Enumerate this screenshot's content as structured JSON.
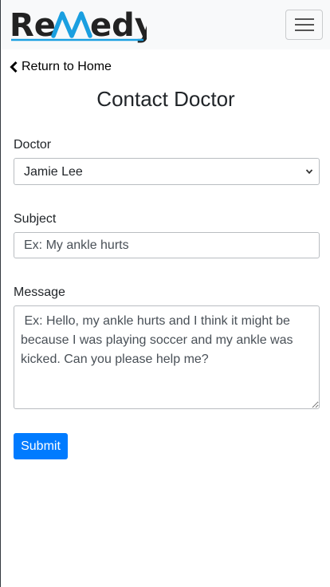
{
  "navbar": {
    "brand": {
      "left": "Re",
      "right": "edy"
    },
    "toggler_icon": "hamburger-menu-icon"
  },
  "back_link": {
    "label": "Return to Home",
    "icon": "chevron-left-icon"
  },
  "page_title": "Contact Doctor",
  "form": {
    "doctor": {
      "label": "Doctor",
      "selected": "Jamie Lee"
    },
    "subject": {
      "label": "Subject",
      "placeholder": "Ex: My ankle hurts",
      "value": ""
    },
    "message": {
      "label": "Message",
      "placeholder": " Ex: Hello, my ankle hurts and I think it might be because I was playing soccer and my ankle was kicked. Can you please help me?",
      "value": ""
    },
    "submit_label": "Submit"
  },
  "colors": {
    "primary": "#007bff",
    "brand_accent": "#1a9fe0",
    "navbar_bg": "#f8f9fa",
    "text": "#212529"
  }
}
